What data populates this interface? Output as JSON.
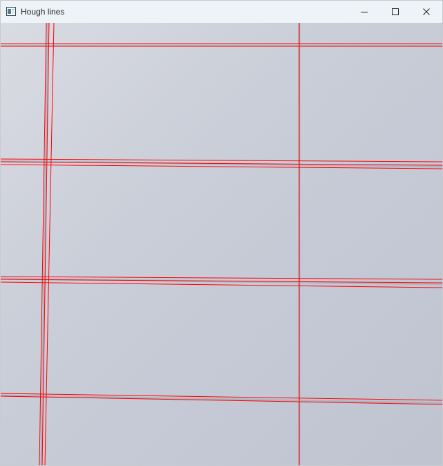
{
  "window": {
    "title": "Hough lines",
    "icons": {
      "app": "app-window-icon",
      "minimize": "minimize-icon",
      "maximize": "maximize-icon",
      "close": "close-icon"
    }
  },
  "image": {
    "content": "image-with-detected-lines",
    "line_color": "#ff0000",
    "background_color": "#c9ccd8",
    "tile_edge_color": "#9fa5b3"
  }
}
